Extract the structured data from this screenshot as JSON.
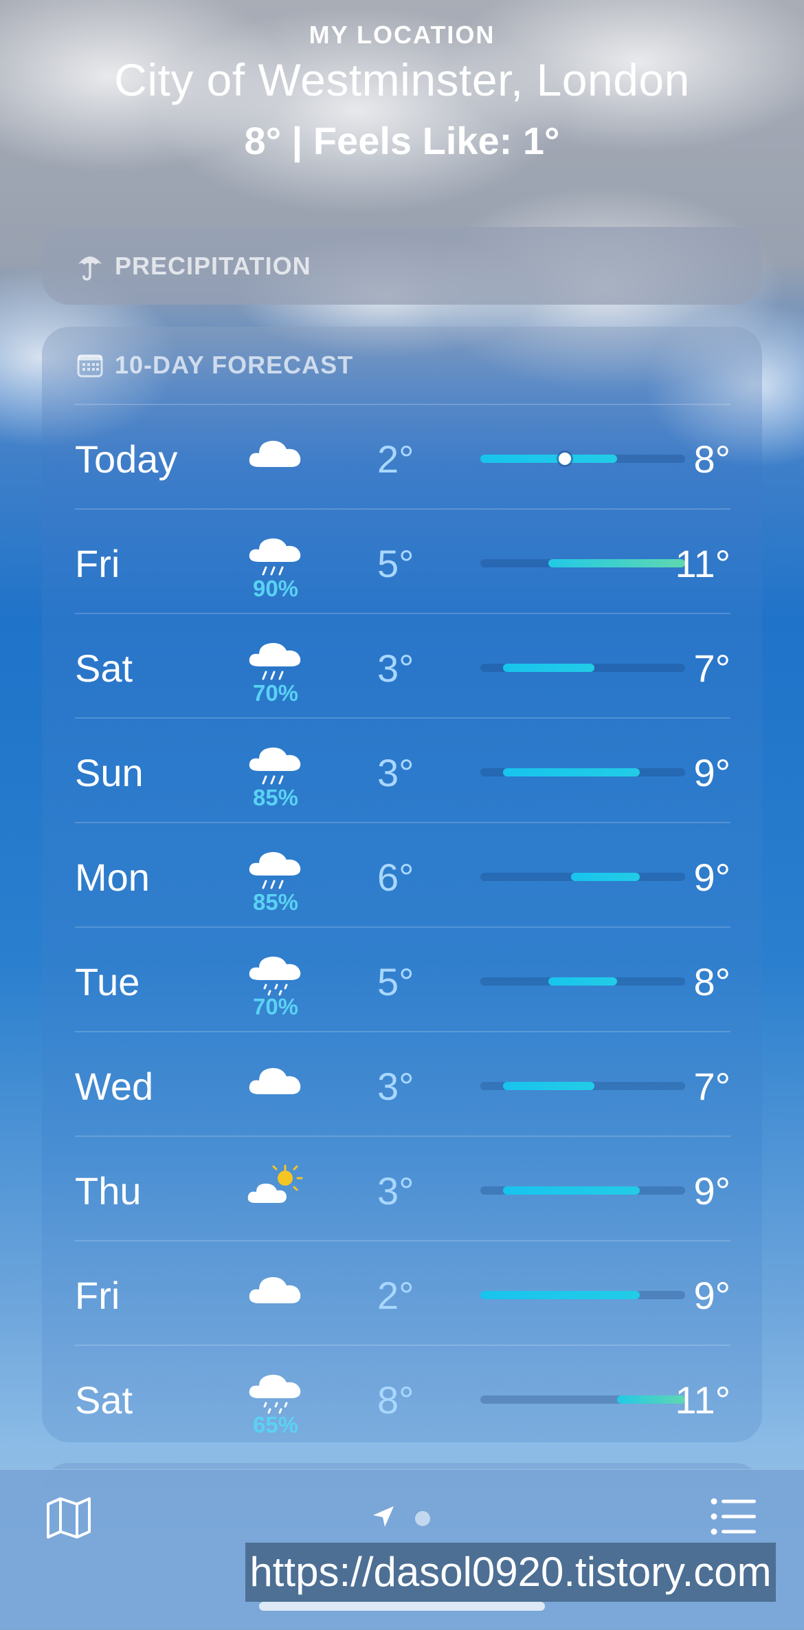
{
  "header": {
    "location_label": "MY LOCATION",
    "city": "City of Westminster, London",
    "conditions": "8°  |  Feels Like: 1°"
  },
  "precipitation": {
    "title": "PRECIPITATION",
    "icon": "umbrella-icon"
  },
  "forecast": {
    "title": "10-DAY FORECAST",
    "icon": "calendar-icon",
    "days": [
      {
        "day": "Today",
        "icon": "cloud-icon",
        "pop": "",
        "low": "2°",
        "high": "8°",
        "low_val": 2,
        "high_val": 8,
        "current": 8
      },
      {
        "day": "Fri",
        "icon": "rain-icon",
        "pop": "90%",
        "low": "5°",
        "high": "11°",
        "low_val": 5,
        "high_val": 11
      },
      {
        "day": "Sat",
        "icon": "rain-icon",
        "pop": "70%",
        "low": "3°",
        "high": "7°",
        "low_val": 3,
        "high_val": 7
      },
      {
        "day": "Sun",
        "icon": "rain-icon",
        "pop": "85%",
        "low": "3°",
        "high": "9°",
        "low_val": 3,
        "high_val": 9
      },
      {
        "day": "Mon",
        "icon": "rain-icon",
        "pop": "85%",
        "low": "6°",
        "high": "9°",
        "low_val": 6,
        "high_val": 9
      },
      {
        "day": "Tue",
        "icon": "drizzle-icon",
        "pop": "70%",
        "low": "5°",
        "high": "8°",
        "low_val": 5,
        "high_val": 8
      },
      {
        "day": "Wed",
        "icon": "cloud-icon",
        "pop": "",
        "low": "3°",
        "high": "7°",
        "low_val": 3,
        "high_val": 7
      },
      {
        "day": "Thu",
        "icon": "partly-sunny-icon",
        "pop": "",
        "low": "3°",
        "high": "9°",
        "low_val": 3,
        "high_val": 9
      },
      {
        "day": "Fri",
        "icon": "cloud-icon",
        "pop": "",
        "low": "2°",
        "high": "9°",
        "low_val": 2,
        "high_val": 9
      },
      {
        "day": "Sat",
        "icon": "drizzle-icon",
        "pop": "65%",
        "low": "8°",
        "high": "11°",
        "low_val": 8,
        "high_val": 11
      }
    ],
    "range_min": 2,
    "range_max": 11
  },
  "tabbar": {
    "map_icon": "map-icon",
    "location_icon": "location-arrow-icon",
    "list_icon": "list-icon"
  },
  "watermark": "https://dasol0920.tistory.com",
  "colors": {
    "pop_blue": "#5ad2f4",
    "bar_cool": "#1ec8ea",
    "bar_warm": "#3fd3c0"
  }
}
